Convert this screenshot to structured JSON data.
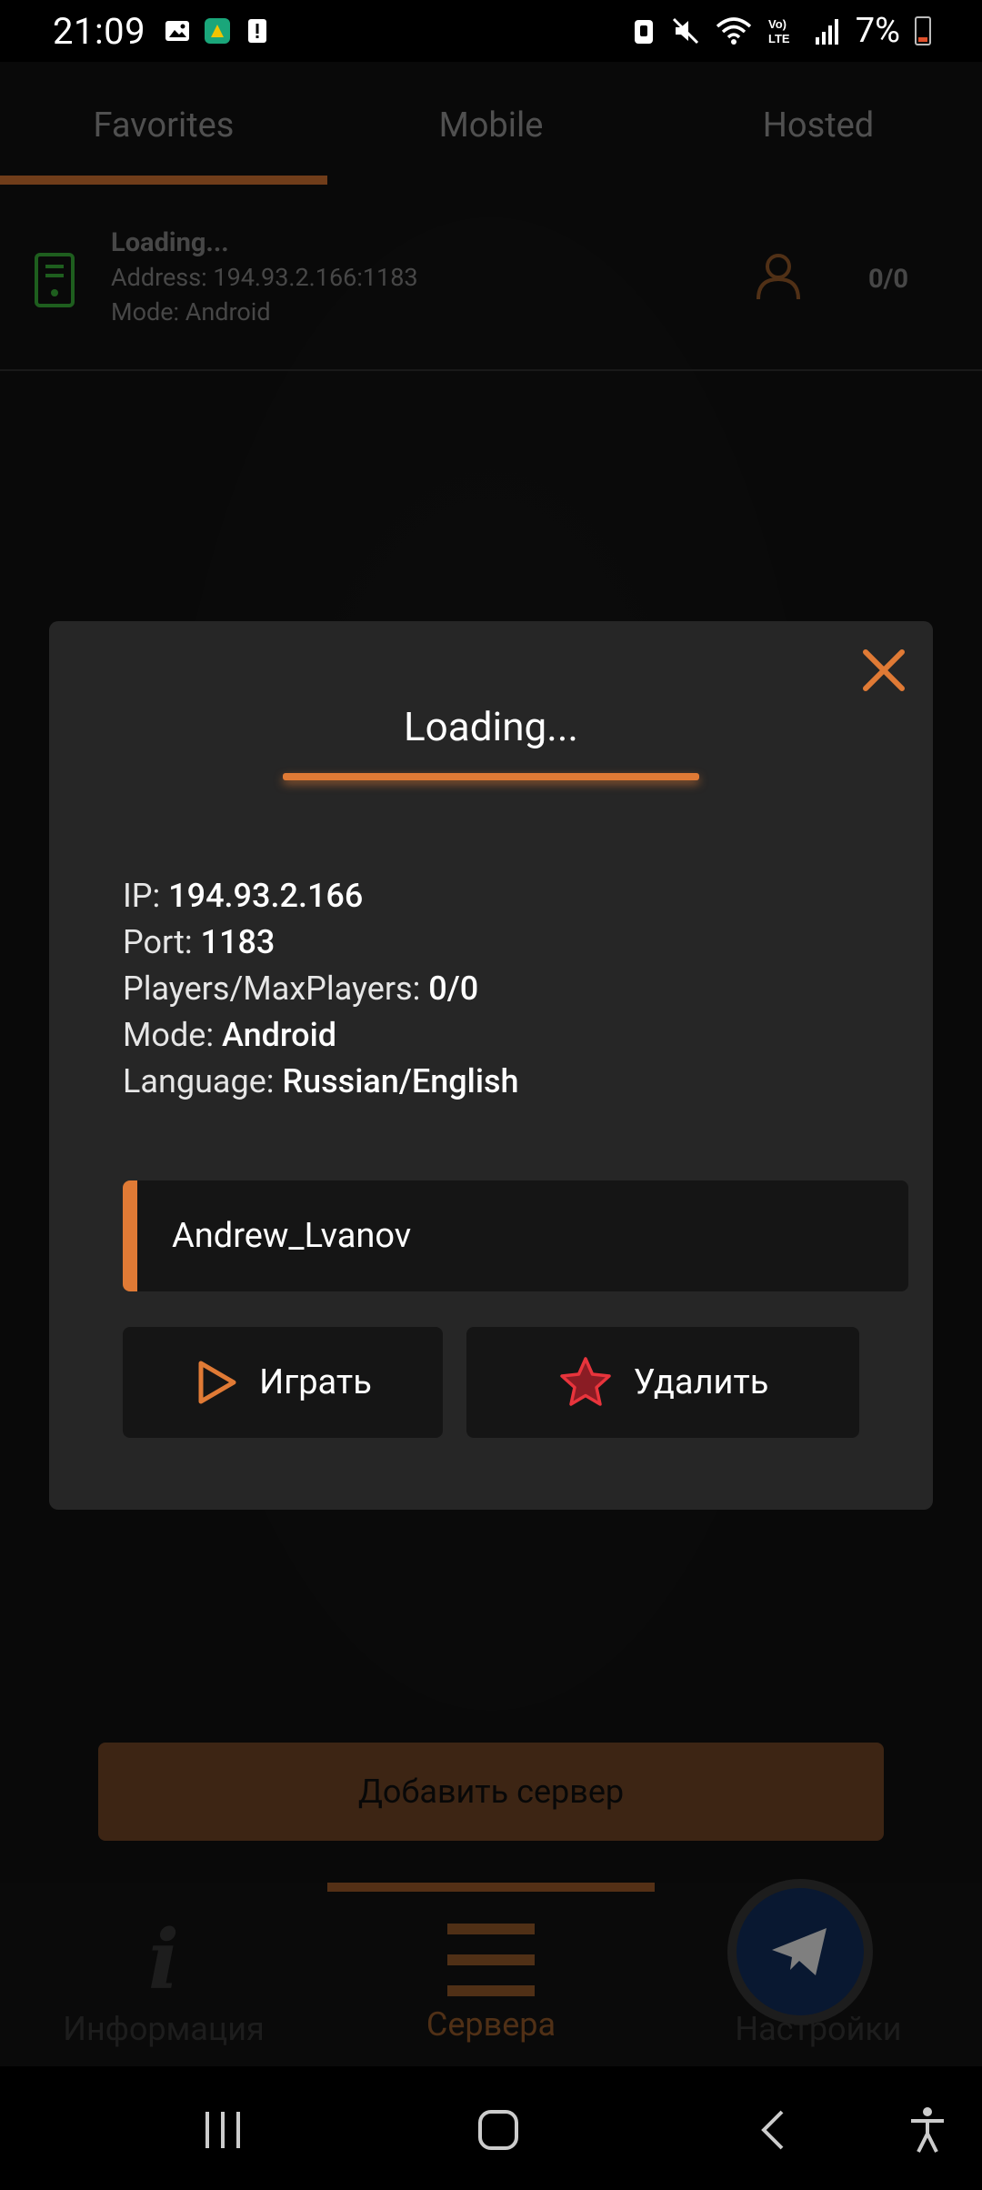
{
  "status_bar": {
    "time": "21:09",
    "battery": "7%",
    "icons": [
      "gallery-icon",
      "app-icon",
      "alert-icon",
      "lock-icon",
      "mute-icon",
      "wifi-icon",
      "volte-icon",
      "signal-icon",
      "battery-icon"
    ]
  },
  "tabs": [
    {
      "label": "Favorites",
      "active": true
    },
    {
      "label": "Mobile",
      "active": false
    },
    {
      "label": "Hosted",
      "active": false
    }
  ],
  "server": {
    "name": "Loading...",
    "address": "Address: 194.93.2.166:1183",
    "mode": "Mode: Android",
    "players": "0/0"
  },
  "modal": {
    "title": "Loading...",
    "ip_label": "IP:",
    "ip_value": "194.93.2.166",
    "port_label": "Port:",
    "port_value": "1183",
    "players_label": "Players/MaxPlayers:",
    "players_value": "0/0",
    "mode_label": "Mode:",
    "mode_value": "Android",
    "language_label": "Language:",
    "language_value": "Russian/English",
    "nickname": "Andrew_Lvanov",
    "play_label": "Играть",
    "delete_label": "Удалить"
  },
  "add_server_label": "Добавить сервер",
  "bottom_nav": [
    {
      "label": "Информация",
      "active": false
    },
    {
      "label": "Сервера",
      "active": true
    },
    {
      "label": "Настройки",
      "active": false
    }
  ],
  "colors": {
    "accent": "#e07a35",
    "online": "#3dbd3d",
    "telegram": "#123063",
    "star": "#e8343c"
  }
}
